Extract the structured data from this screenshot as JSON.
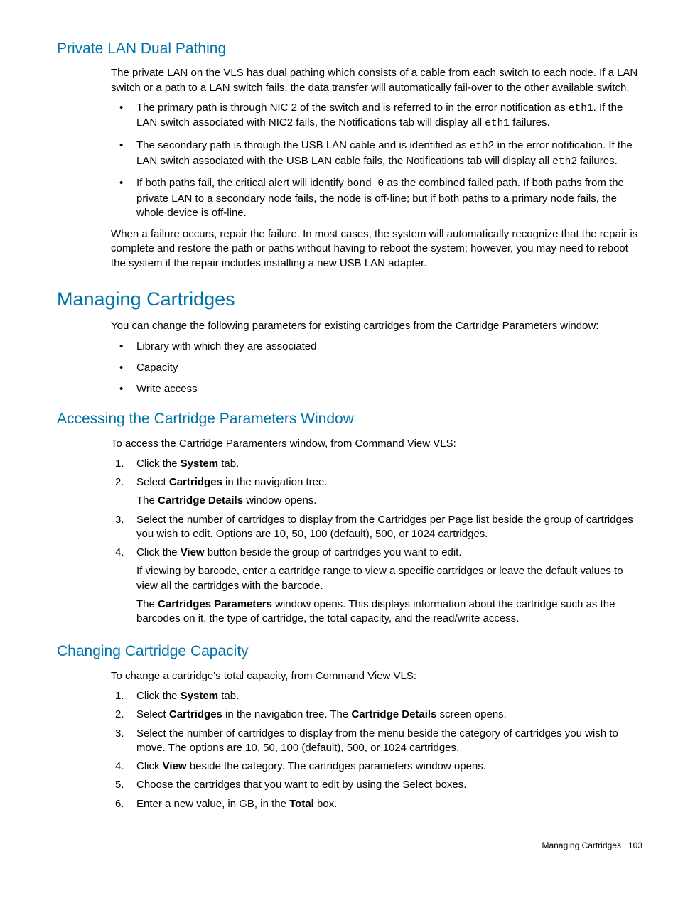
{
  "sec1": {
    "title": "Private LAN Dual Pathing",
    "intro": "The private LAN on the VLS has dual pathing which consists of a cable from each switch to each node. If a LAN switch or a path to a LAN switch fails, the data transfer will automatically fail-over to the other available switch.",
    "b1a": "The primary path is through NIC 2 of the switch and is referred to in the error notification as ",
    "b1code1": "eth1",
    "b1b": ". If the LAN switch associated with NIC2 fails, the Notifications tab will display all ",
    "b1code2": "eth1",
    "b1c": " failures.",
    "b2a": "The secondary path is through the USB LAN cable and is identified as ",
    "b2code1": "eth2",
    "b2b": " in the error notification. If the LAN switch associated with the USB LAN cable fails, the Notifications tab will display all ",
    "b2code2": "eth2",
    "b2c": " failures.",
    "b3a": "If both paths fail, the critical alert will identify ",
    "b3code1": "bond 0",
    "b3b": " as the combined failed path. If both paths from the private LAN to a secondary node fails, the node is off-line; but if both paths to a primary node fails, the whole device is off-line.",
    "outro": "When a failure occurs, repair the failure. In most cases, the system will automatically recognize that the repair is complete and restore the path or paths without having to reboot the system; however, you may need to reboot the system if the repair includes installing a new USB LAN adapter."
  },
  "sec2": {
    "title": "Managing Cartridges",
    "intro": "You can change the following parameters for existing cartridges from the Cartridge Parameters window:",
    "b1": "Library with which they are associated",
    "b2": "Capacity",
    "b3": "Write access"
  },
  "sec3": {
    "title": "Accessing the Cartridge Parameters Window",
    "intro": "To access the Cartridge Paramenters window, from Command View VLS:",
    "s1a": "Click the ",
    "s1b": "System",
    "s1c": " tab.",
    "s2a": "Select ",
    "s2b": "Cartridges",
    "s2c": " in the navigation tree.",
    "s2sub_a": "The ",
    "s2sub_b": "Cartridge Details",
    "s2sub_c": " window opens.",
    "s3": "Select the number of cartridges to display from the Cartridges per Page list beside the group of cartridges you wish to edit. Options are 10, 50, 100 (default), 500, or 1024 cartridges.",
    "s4a": "Click the ",
    "s4b": "View",
    "s4c": " button beside the group of cartridges you want to edit.",
    "s4sub1": "If viewing by barcode, enter a cartridge range to view a specific cartridges or leave the default values to view all the cartridges with the barcode.",
    "s4sub2a": "The ",
    "s4sub2b": "Cartridges Parameters",
    "s4sub2c": " window opens. This displays information about the cartridge such as the barcodes on it, the type of cartridge, the total capacity, and the read/write access."
  },
  "sec4": {
    "title": "Changing Cartridge Capacity",
    "intro": "To change a cartridge's total capacity, from Command View VLS:",
    "s1a": "Click the ",
    "s1b": "System",
    "s1c": " tab.",
    "s2a": "Select ",
    "s2b": "Cartridges",
    "s2c": " in the navigation tree. The ",
    "s2d": "Cartridge Details",
    "s2e": " screen opens.",
    "s3": "Select the number of cartridges to display from the menu beside the category of cartridges you wish to move. The options are 10, 50, 100 (default), 500, or 1024 cartridges.",
    "s4a": "Click ",
    "s4b": "View",
    "s4c": " beside the category. The cartridges parameters window opens.",
    "s5": "Choose the cartridges that you want to edit by using the Select boxes.",
    "s6a": "Enter a new value, in GB, in the ",
    "s6b": "Total",
    "s6c": " box."
  },
  "footer": {
    "label": "Managing Cartridges",
    "page": "103"
  }
}
